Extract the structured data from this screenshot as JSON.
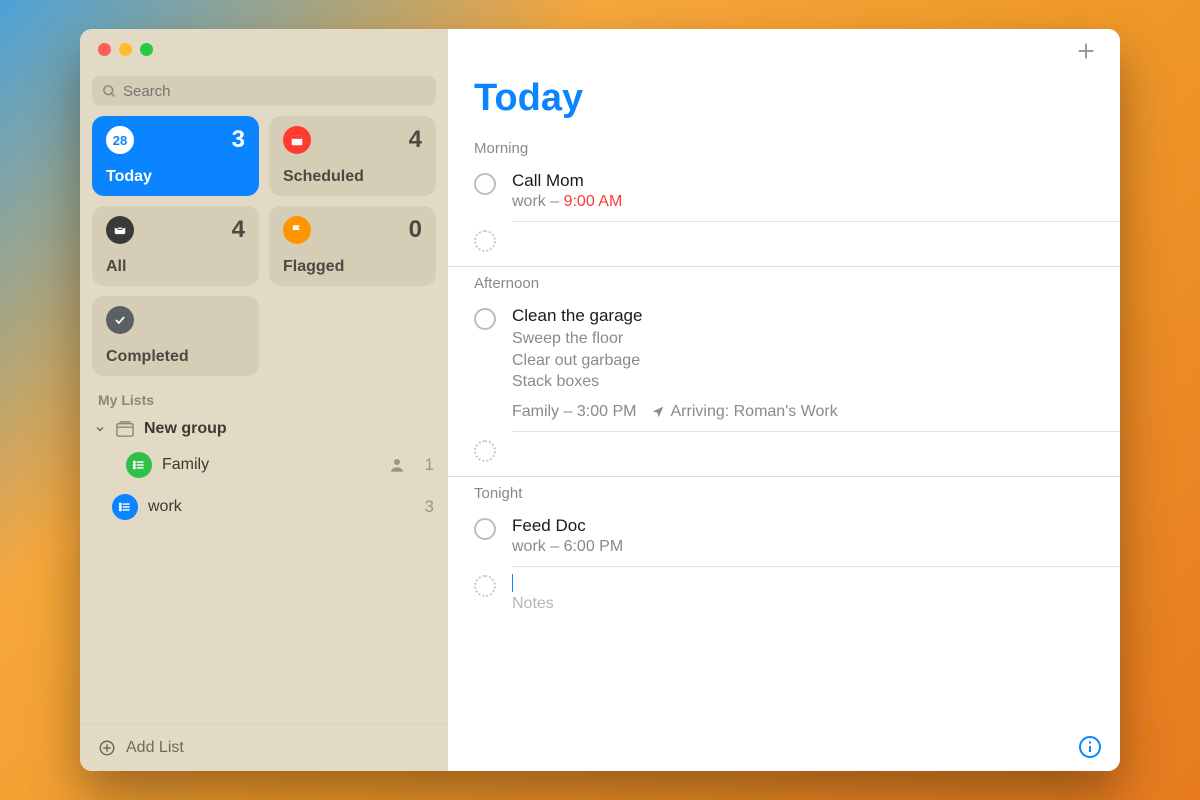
{
  "window": {
    "title_color": "#0b84ff"
  },
  "sidebar": {
    "search_placeholder": "Search",
    "smart": {
      "today": {
        "label": "Today",
        "count": "3"
      },
      "scheduled": {
        "label": "Scheduled",
        "count": "4"
      },
      "all": {
        "label": "All",
        "count": "4"
      },
      "flagged": {
        "label": "Flagged",
        "count": "0"
      },
      "completed": {
        "label": "Completed"
      },
      "today_icon_day": "28"
    },
    "section_label": "My Lists",
    "group": {
      "name": "New group"
    },
    "lists": [
      {
        "name": "Family",
        "color": "#30c048",
        "shared": true,
        "count": "1"
      },
      {
        "name": "work",
        "color": "#0b84ff",
        "shared": false,
        "count": "3"
      }
    ],
    "add_list_label": "Add List"
  },
  "main": {
    "title": "Today",
    "sections": [
      {
        "name": "Morning",
        "tasks": [
          {
            "title": "Call Mom",
            "list": "work",
            "time": "9:00 AM",
            "time_overdue": true
          }
        ]
      },
      {
        "name": "Afternoon",
        "tasks": [
          {
            "title": "Clean the garage",
            "notes": "Sweep the floor\nClear out garbage\nStack boxes",
            "list": "Family",
            "time": "3:00 PM",
            "location": "Arriving: Roman's Work"
          }
        ]
      },
      {
        "name": "Tonight",
        "tasks": [
          {
            "title": "Feed Doc",
            "list": "work",
            "time": "6:00 PM"
          }
        ],
        "editing_new": {
          "notes_placeholder": "Notes"
        }
      }
    ]
  }
}
